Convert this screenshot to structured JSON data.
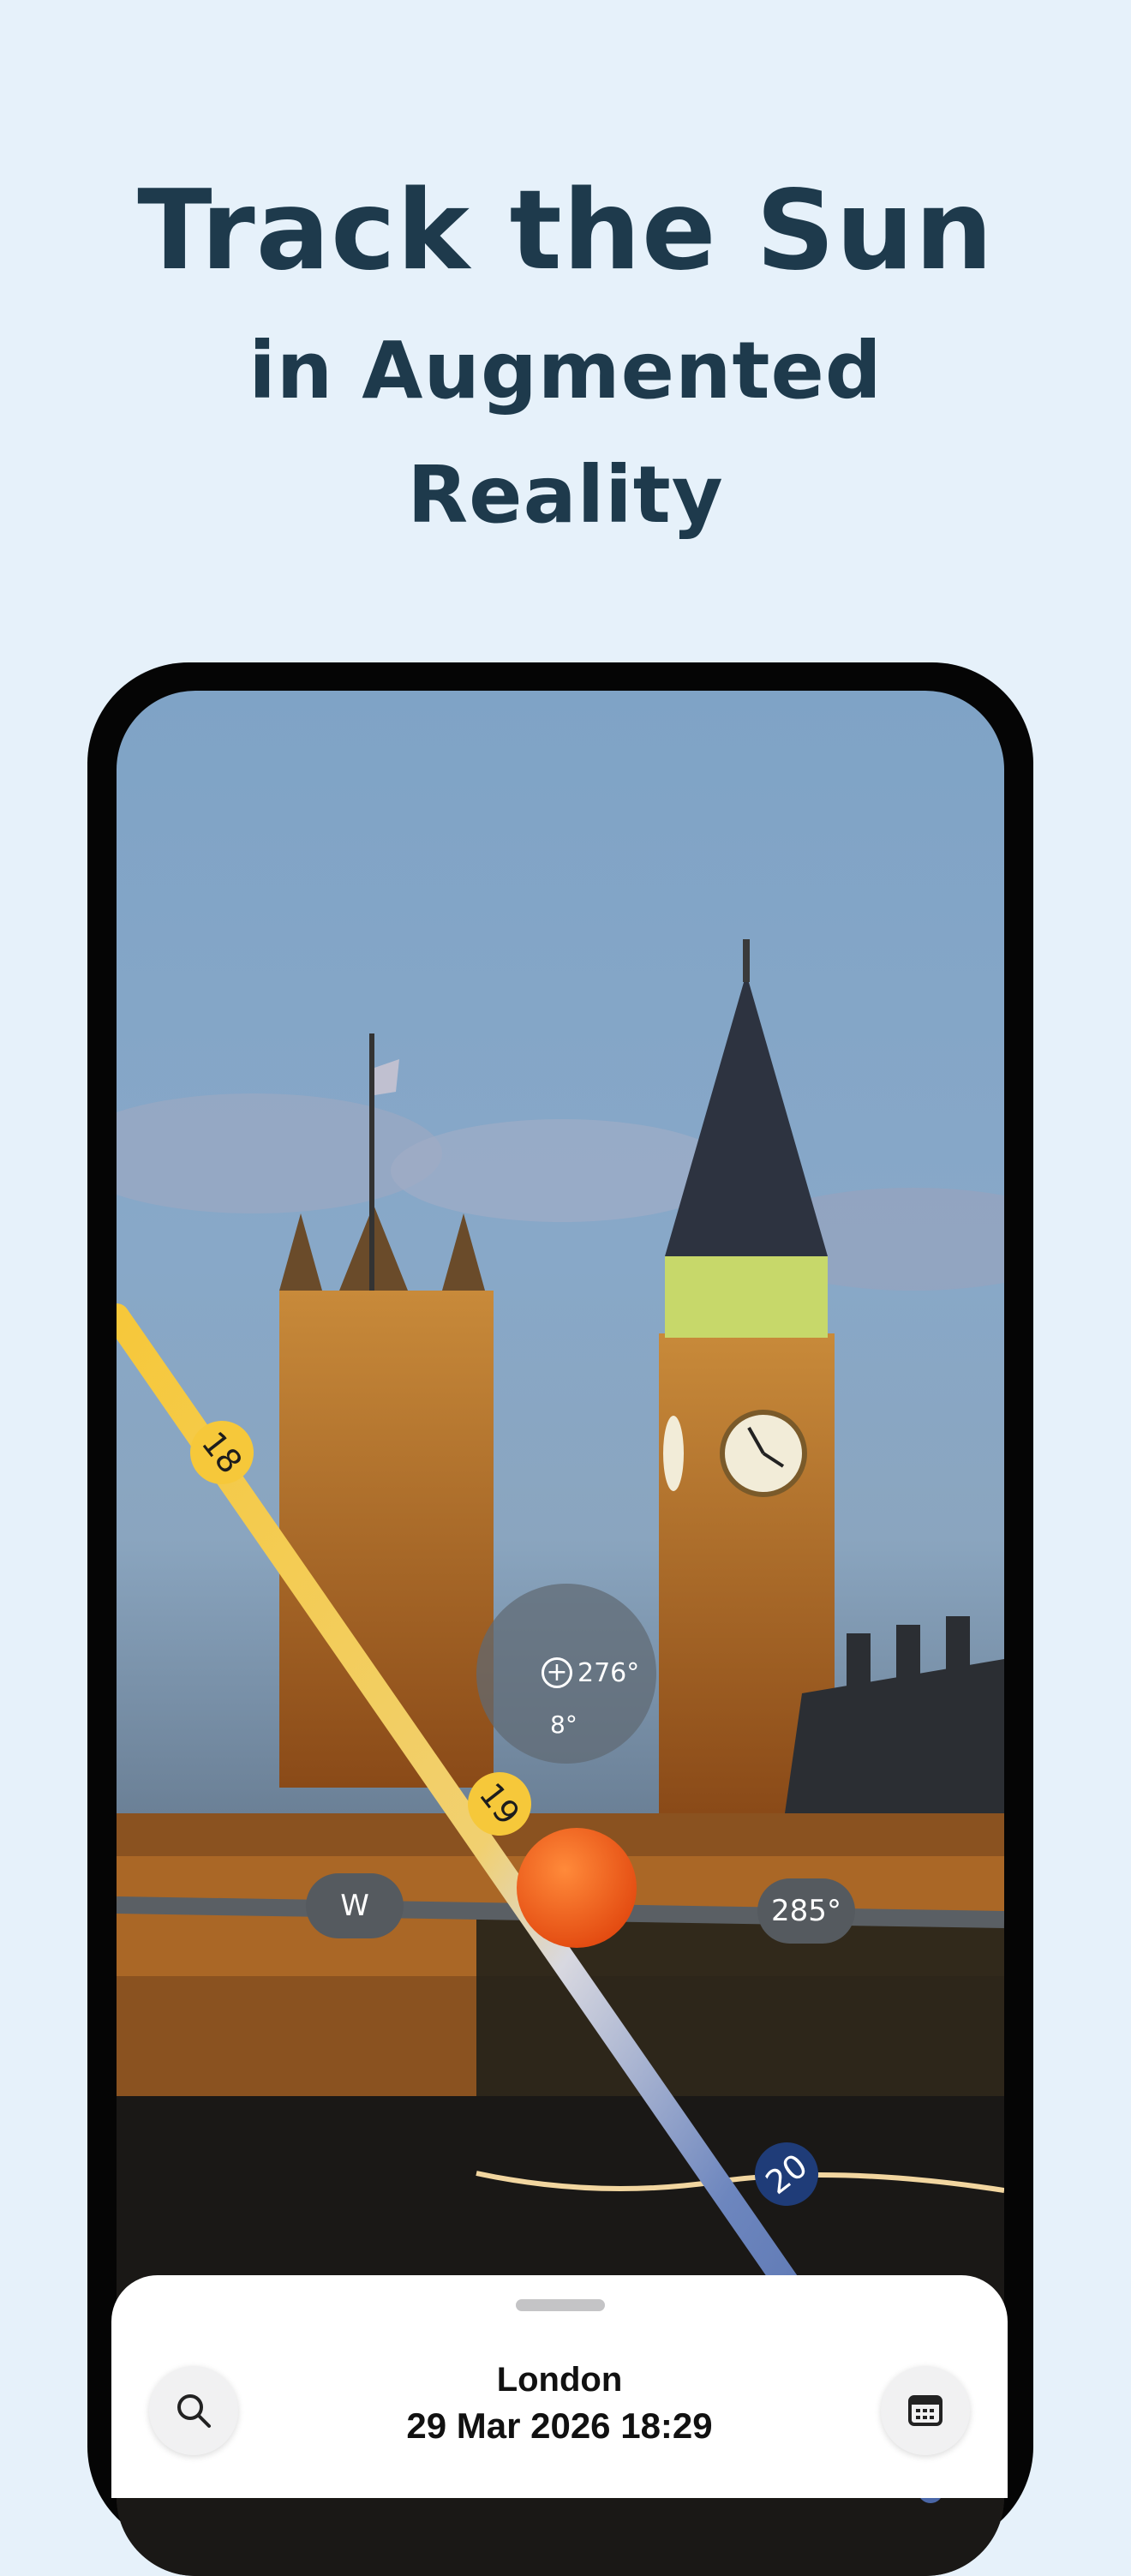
{
  "headline": {
    "line1": "Track the Sun",
    "line2": "in Augmented",
    "line3": "Reality"
  },
  "ar_view": {
    "sun_readout": {
      "azimuth": "276°",
      "elevation": "8°"
    },
    "horizon": {
      "direction_label": "W",
      "bearing_label": "285°"
    },
    "sun_path_hours": [
      "18",
      "19",
      "20"
    ],
    "colors": {
      "path_yellow": "#f6c83a",
      "path_blue": "#5573b0",
      "sun": "#f0561a",
      "horizon": "#5a5f64"
    }
  },
  "bottom_sheet": {
    "location": "London",
    "datetime": "29 Mar 2026 18:29",
    "search_icon": "magnifier",
    "calendar_icon": "calendar"
  }
}
